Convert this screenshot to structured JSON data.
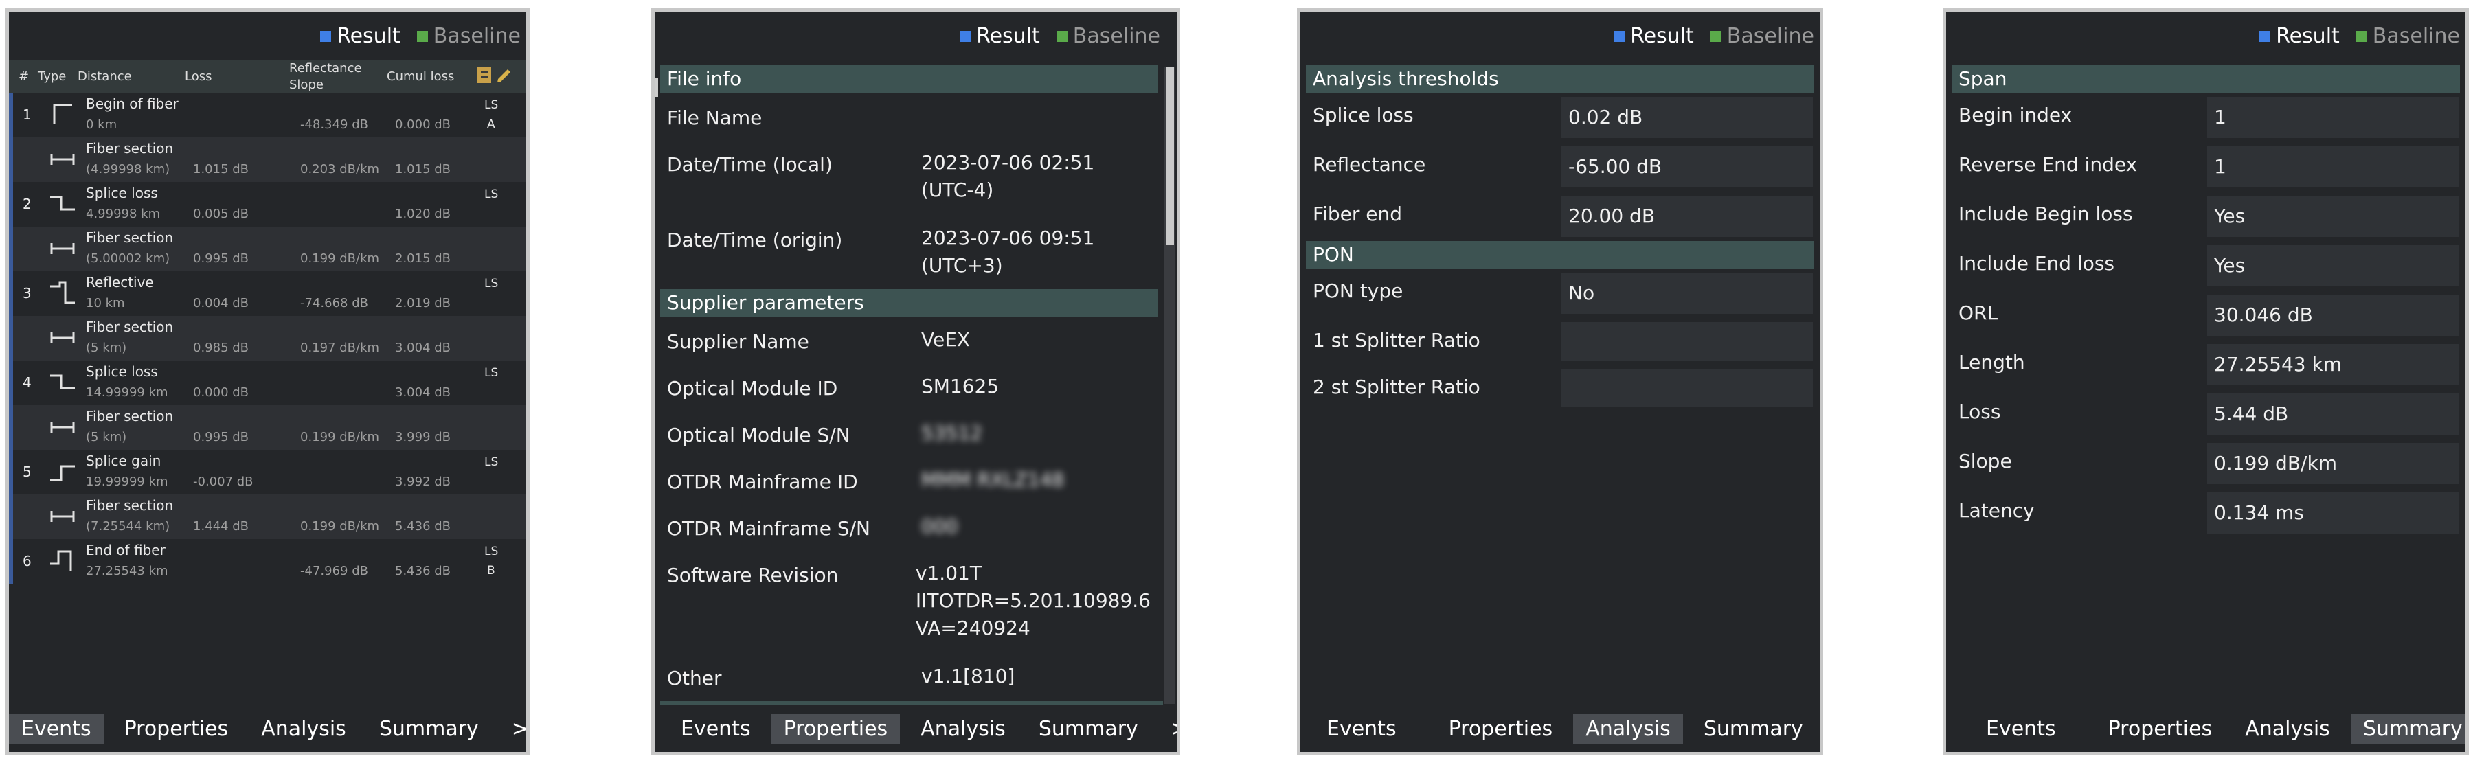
{
  "legend": {
    "result": "Result",
    "baseline": "Baseline",
    "result_color": "#3f7fe6",
    "baseline_color": "#5aaa4a"
  },
  "tabs": {
    "events": "Events",
    "properties": "Properties",
    "analysis": "Analysis",
    "summary": "Summary",
    "more": ">>"
  },
  "events_table": {
    "headers": {
      "num": "#",
      "type": "Type",
      "distance": "Distance",
      "loss": "Loss",
      "reflectance": "Reflectance",
      "slope": "Slope",
      "cumul": "Cumul loss"
    },
    "rows": [
      {
        "num": "1",
        "name": "Begin of fiber",
        "distance": "0 km",
        "loss": "",
        "refl": "-48.349 dB",
        "cumul": "0.000 dB",
        "ls": "LS",
        "ab": "A",
        "kind": "begin"
      },
      {
        "num": "",
        "name": "Fiber section",
        "distance": "(4.99998 km)",
        "loss": "1.015 dB",
        "refl": "0.203 dB/km",
        "cumul": "1.015 dB",
        "ls": "",
        "ab": "",
        "kind": "section"
      },
      {
        "num": "2",
        "name": "Splice loss",
        "distance": "4.99998 km",
        "loss": "0.005 dB",
        "refl": "",
        "cumul": "1.020 dB",
        "ls": "LS",
        "ab": "",
        "kind": "splice"
      },
      {
        "num": "",
        "name": "Fiber section",
        "distance": "(5.00002 km)",
        "loss": "0.995 dB",
        "refl": "0.199 dB/km",
        "cumul": "2.015 dB",
        "ls": "",
        "ab": "",
        "kind": "section"
      },
      {
        "num": "3",
        "name": "Reflective",
        "distance": "10 km",
        "loss": "0.004 dB",
        "refl": "-74.668 dB",
        "cumul": "2.019 dB",
        "ls": "LS",
        "ab": "",
        "kind": "reflective"
      },
      {
        "num": "",
        "name": "Fiber section",
        "distance": "(5 km)",
        "loss": "0.985 dB",
        "refl": "0.197 dB/km",
        "cumul": "3.004 dB",
        "ls": "",
        "ab": "",
        "kind": "section"
      },
      {
        "num": "4",
        "name": "Splice loss",
        "distance": "14.99999 km",
        "loss": "0.000 dB",
        "refl": "",
        "cumul": "3.004 dB",
        "ls": "LS",
        "ab": "",
        "kind": "splice"
      },
      {
        "num": "",
        "name": "Fiber section",
        "distance": "(5 km)",
        "loss": "0.995 dB",
        "refl": "0.199 dB/km",
        "cumul": "3.999 dB",
        "ls": "",
        "ab": "",
        "kind": "section"
      },
      {
        "num": "5",
        "name": "Splice gain",
        "distance": "19.99999 km",
        "loss": "-0.007 dB",
        "refl": "",
        "cumul": "3.992 dB",
        "ls": "LS",
        "ab": "",
        "kind": "gain"
      },
      {
        "num": "",
        "name": "Fiber section",
        "distance": "(7.25544 km)",
        "loss": "1.444 dB",
        "refl": "0.199 dB/km",
        "cumul": "5.436 dB",
        "ls": "",
        "ab": "",
        "kind": "section"
      },
      {
        "num": "6",
        "name": "End of fiber",
        "distance": "27.25543 km",
        "loss": "",
        "refl": "-47.969 dB",
        "cumul": "5.436 dB",
        "ls": "LS",
        "ab": "B",
        "kind": "end"
      }
    ]
  },
  "properties": {
    "file_info": "File info",
    "file_name_lbl": "File Name",
    "file_name": "",
    "dt_local_lbl": "Date/Time (local)",
    "dt_local": "2023-07-06 02:51 (UTC-4)",
    "dt_origin_lbl": "Date/Time (origin)",
    "dt_origin": "2023-07-06 09:51 (UTC+3)",
    "supplier_params": "Supplier parameters",
    "supplier_name_lbl": "Supplier Name",
    "supplier_name": "VeEX",
    "module_id_lbl": "Optical Module ID",
    "module_id": "SM1625",
    "module_sn_lbl": "Optical Module S/N",
    "module_sn": "53512",
    "mainframe_id_lbl": "OTDR Mainframe ID",
    "mainframe_id": "MMM RXLZ148",
    "mainframe_sn_lbl": "OTDR Mainframe S/N",
    "mainframe_sn": "000",
    "software_rev_lbl": "Software Revision",
    "software_rev_1": "v1.01T",
    "software_rev_2": "IITOTDR=5.201.10989.6",
    "software_rev_3": "VA=240924",
    "other_lbl": "Other",
    "other": "v1.1[810]"
  },
  "analysis": {
    "thresholds": "Analysis thresholds",
    "splice_loss_lbl": "Splice loss",
    "splice_loss": "0.02 dB",
    "reflectance_lbl": "Reflectance",
    "reflectance": "-65.00 dB",
    "fiber_end_lbl": "Fiber end",
    "fiber_end": "20.00 dB",
    "pon": "PON",
    "pon_type_lbl": "PON type",
    "pon_type": "No",
    "split1_lbl": "1 st Splitter Ratio",
    "split1": "",
    "split2_lbl": "2 st Splitter Ratio",
    "split2": ""
  },
  "summary": {
    "span": "Span",
    "begin_index_lbl": "Begin index",
    "begin_index": "1",
    "rev_end_lbl": "Reverse End index",
    "rev_end": "1",
    "inc_begin_lbl": "Include Begin loss",
    "inc_begin": "Yes",
    "inc_end_lbl": "Include End loss",
    "inc_end": "Yes",
    "orl_lbl": "ORL",
    "orl": "30.046 dB",
    "length_lbl": "Length",
    "length": "27.25543 km",
    "loss_lbl": "Loss",
    "loss": "5.44 dB",
    "slope_lbl": "Slope",
    "slope": "0.199 dB/km",
    "latency_lbl": "Latency",
    "latency": "0.134 ms"
  }
}
